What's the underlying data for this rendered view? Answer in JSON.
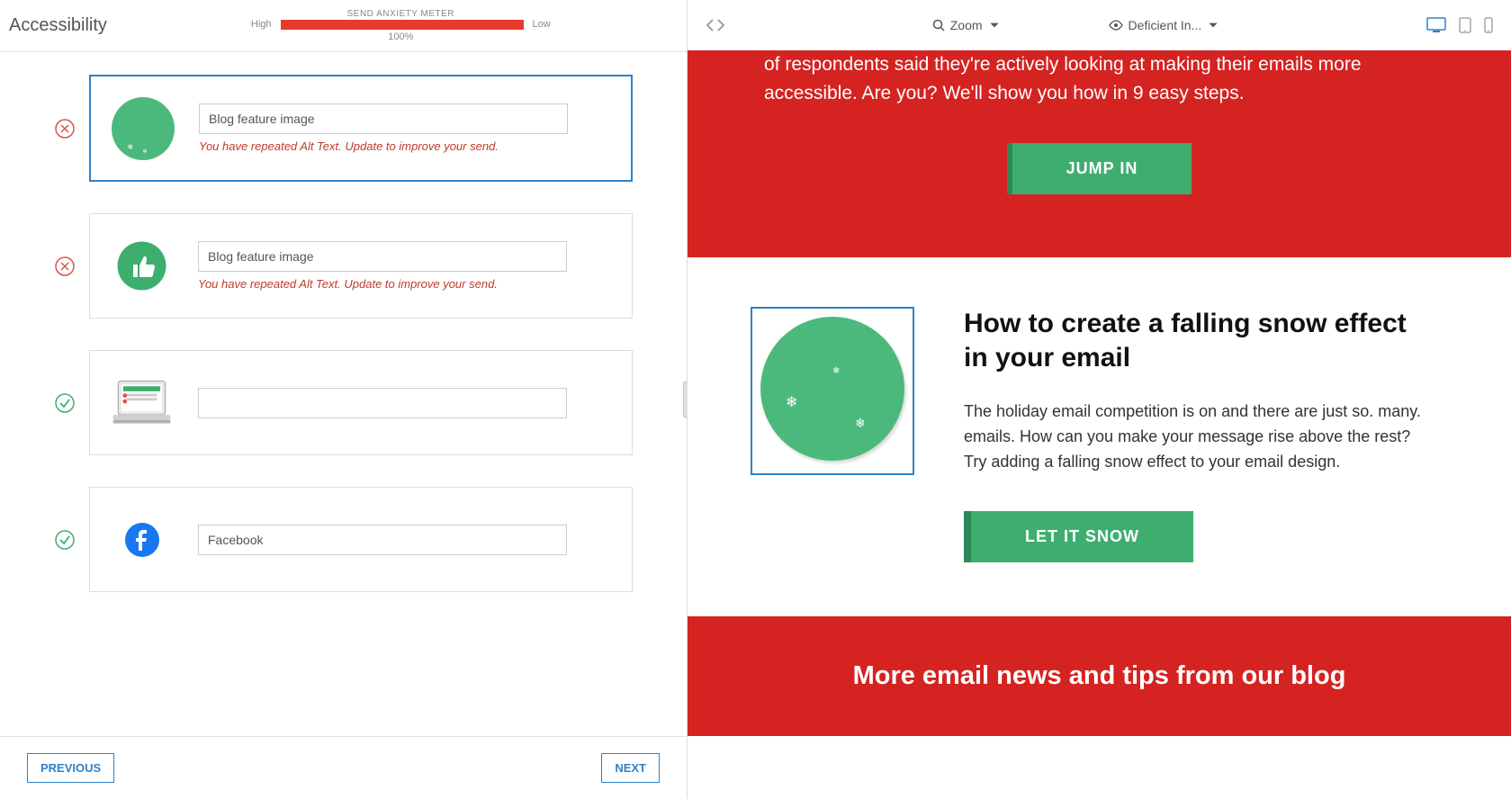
{
  "header": {
    "title": "Accessibility",
    "meter": {
      "label": "SEND ANXIETY METER",
      "high": "High",
      "low": "Low",
      "percent": "100%"
    }
  },
  "items": [
    {
      "status": "error",
      "thumb": "snow-circle",
      "alt": "Blog feature image",
      "warning": "You have repeated Alt Text. Update to improve your send.",
      "selected": true
    },
    {
      "status": "error",
      "thumb": "thumbsup-circle",
      "alt": "Blog feature image",
      "warning": "You have repeated Alt Text. Update to improve your send.",
      "selected": false
    },
    {
      "status": "ok",
      "thumb": "laptop",
      "alt": "",
      "warning": "",
      "selected": false
    },
    {
      "status": "ok",
      "thumb": "facebook",
      "alt": "Facebook",
      "warning": "",
      "selected": false
    }
  ],
  "footer": {
    "prev": "PREVIOUS",
    "next": "NEXT"
  },
  "toolbar": {
    "zoom": "Zoom",
    "mode": "Deficient In..."
  },
  "preview": {
    "hero_text": "of respondents said they're actively looking at making their emails more accessible. Are you? We'll show you how in 9 easy steps.",
    "hero_cta": "JUMP IN",
    "article": {
      "title": "How to create a falling snow effect in your email",
      "body": "The holiday email competition is on and there are just so. many. emails. How can you make your message rise above the rest? Try adding a falling snow effect to your email design.",
      "cta": "LET IT SNOW"
    },
    "banner": "More email news and tips from our blog"
  }
}
